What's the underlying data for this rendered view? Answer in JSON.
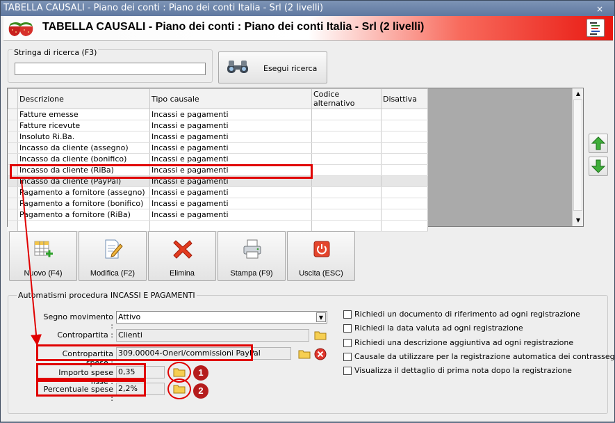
{
  "window": {
    "title": "TABELLA CAUSALI - Piano dei conti : Piano dei conti Italia - Srl (2 livelli)",
    "close_glyph": "×"
  },
  "header": {
    "title": "TABELLA CAUSALI - Piano dei conti : Piano dei conti Italia - Srl (2 livelli)",
    "logo_icon": "strawberry-logo-icon",
    "menu_icon": "menu-icon"
  },
  "search": {
    "group_label": "Stringa di ricerca (F3)",
    "value": "",
    "button_label": "Esegui ricerca"
  },
  "table": {
    "columns": [
      "Descrizione",
      "Tipo causale",
      "Codice alternativo",
      "Disattiva"
    ],
    "rows": [
      [
        "Fatture emesse",
        "Incassi e pagamenti",
        "",
        ""
      ],
      [
        "Fatture ricevute",
        "Incassi e pagamenti",
        "",
        ""
      ],
      [
        "Insoluto Ri.Ba.",
        "Incassi e pagamenti",
        "",
        ""
      ],
      [
        "Incasso da cliente (assegno)",
        "Incassi e pagamenti",
        "",
        ""
      ],
      [
        "Incasso da cliente (bonifico)",
        "Incassi e pagamenti",
        "",
        ""
      ],
      [
        "Incasso da cliente (RiBa)",
        "Incassi e pagamenti",
        "",
        ""
      ],
      [
        "Incasso da cliente (PayPal)",
        "Incassi e pagamenti",
        "",
        ""
      ],
      [
        "Pagamento a fornitore (assegno)",
        "Incassi e pagamenti",
        "",
        ""
      ],
      [
        "Pagamento a fornitore (bonifico)",
        "Incassi e pagamenti",
        "",
        ""
      ],
      [
        "Pagamento a fornitore (RiBa)",
        "Incassi e pagamenti",
        "",
        ""
      ],
      [
        "",
        "",
        "",
        ""
      ]
    ],
    "selected_row": 6
  },
  "toolbar": {
    "new_label": "Nuovo (F4)",
    "edit_label": "Modifica (F2)",
    "delete_label": "Elimina",
    "print_label": "Stampa (F9)",
    "exit_label": "Uscita (ESC)"
  },
  "automation": {
    "group_label": "Automatismi procedura INCASSI E PAGAMENTI",
    "segno_label": "Segno movimento :",
    "segno_value": "Attivo",
    "contropartita_label": "Contropartita :",
    "contropartita_value": "Clienti",
    "spese_label": "Contropartita spese :",
    "spese_value": "309.00004-Oneri/commissioni PayPal",
    "importo_label": "Importo spese fisse :",
    "importo_value": "0,35",
    "percentuale_label": "Percentuale spese :",
    "percentuale_value": "2,2%",
    "checks": [
      {
        "label": "Richiedi un documento di riferimento ad ogni registrazione",
        "checked": false
      },
      {
        "label": "Richiedi la data valuta ad ogni registrazione",
        "checked": false
      },
      {
        "label": "Richiedi una descrizione aggiuntiva ad ogni registrazione",
        "checked": false
      },
      {
        "label": "Causale da utilizzare per la registrazione automatica dei contrassegni",
        "checked": false
      },
      {
        "label": "Visualizza il dettaglio di prima nota dopo la registrazione",
        "checked": false
      }
    ]
  },
  "annotations": {
    "badge1": "1",
    "badge2": "2"
  },
  "colors": {
    "highlight": "#e00000",
    "header_gradient_end": "#e81710",
    "titlebar": "#6f87ad"
  }
}
